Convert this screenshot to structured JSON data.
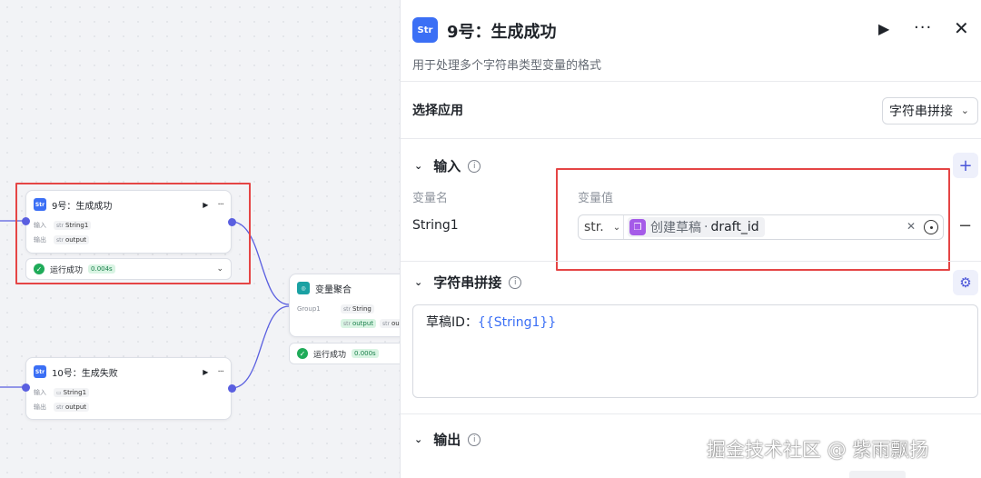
{
  "canvas": {
    "node_success": {
      "title": "9号：生成成功",
      "input_label": "输入",
      "input_type": "str",
      "input_value": "String1",
      "output_label": "输出",
      "output_type": "str",
      "output_value": "output",
      "status_text": "运行成功",
      "status_time": "0.004s"
    },
    "node_fail": {
      "title": "10号：生成失败",
      "input_label": "输入",
      "input_value": "String1",
      "output_label": "输出",
      "output_type": "str",
      "output_value": "output"
    },
    "node_agg": {
      "title": "变量聚合",
      "group_label": "Group1",
      "group_type": "str",
      "group_value": "String",
      "out1": "output",
      "out2_type": "str",
      "out2": "ou",
      "status_text": "运行成功",
      "status_time": "0.000s"
    }
  },
  "panel": {
    "icon_text": "Str",
    "title": "9号：生成成功",
    "description": "用于处理多个字符串类型变量的格式",
    "select_app_label": "选择应用",
    "select_app_value": "字符串拼接",
    "input_section": "输入",
    "col_var_name": "变量名",
    "col_var_value": "变量值",
    "var_name": "String1",
    "var_type": "str.",
    "ref_node": "创建草稿",
    "ref_field": "draft_id",
    "concat_section": "字符串拼接",
    "template_prefix": "草稿ID：",
    "template_var": "{{String1}}",
    "output_section": "输出"
  },
  "watermark": "掘金技术社区 @ 紫雨飘扬",
  "colors": {
    "accent": "#3b6ff5",
    "highlight_border": "#e54545",
    "success": "#1fab59",
    "wire": "#5a5fe0"
  }
}
